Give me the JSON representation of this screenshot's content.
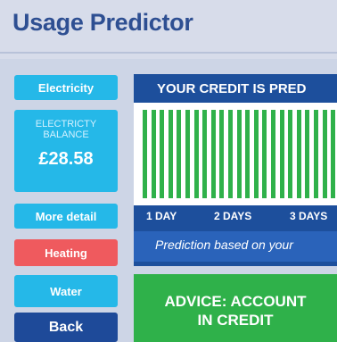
{
  "app": {
    "title": "Usage Predictor"
  },
  "sidebar": {
    "electricity_label": "Electricity",
    "balance_label": "ELECTRICTY BALANCE",
    "balance_value": "£28.58",
    "more_detail_label": "More detail",
    "heating_label": "Heating",
    "water_label": "Water",
    "back_label": "Back"
  },
  "prediction": {
    "header": "YOUR CREDIT IS PRED",
    "bar_count": 23,
    "bar_level": 1.0,
    "days": [
      "1 DAY",
      "2 DAYS",
      "3 DAYS"
    ],
    "note": "Prediction based on your"
  },
  "advice": {
    "line1": "ADVICE: ACCOUNT",
    "line2": "IN CREDIT"
  },
  "colors": {
    "title": "#2e4f92",
    "cyan": "#25b8e8",
    "red": "#ef5a5e",
    "navy": "#1e4a99",
    "green": "#2fb14a"
  }
}
